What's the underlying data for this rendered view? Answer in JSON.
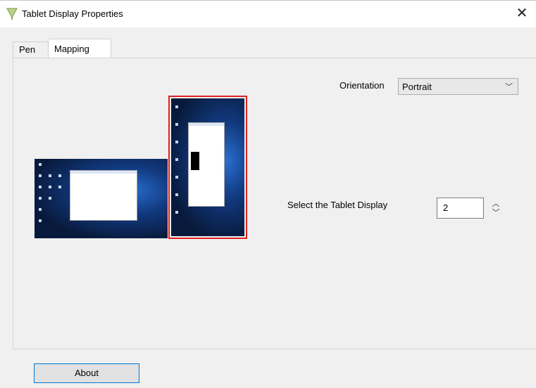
{
  "window": {
    "title": "Tablet Display Properties",
    "close_glyph": "✕"
  },
  "tabs": [
    {
      "label": "Pen",
      "active": false
    },
    {
      "label": "Mapping",
      "active": true
    }
  ],
  "mapping": {
    "orientation_label": "Orientation",
    "orientation_value": "Portrait",
    "display_label": "Select the Tablet Display",
    "display_value": "2"
  },
  "monitors": [
    {
      "index": 1,
      "orientation": "landscape",
      "selected": false
    },
    {
      "index": 2,
      "orientation": "portrait",
      "selected": true
    }
  ],
  "buttons": {
    "about_label": "About"
  },
  "colors": {
    "selection_border": "#e02020",
    "button_focus_border": "#0078d7",
    "desktop_bg": "#123a80"
  },
  "icons": {
    "app": "tablet-pen-icon",
    "dropdown": "chevron-down-icon",
    "spin_up": "chevron-up-icon",
    "spin_down": "chevron-down-icon"
  }
}
